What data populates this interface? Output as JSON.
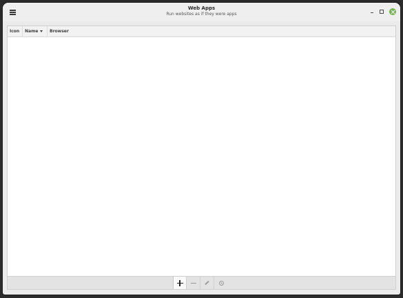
{
  "window": {
    "title": "Web Apps",
    "subtitle": "Run websites as if they were apps"
  },
  "table": {
    "columns": [
      "Icon",
      "Name",
      "Browser"
    ],
    "sorted_column": "Name",
    "sort_direction": "descending",
    "rows": []
  },
  "toolbar": {
    "add_icon": "plus-icon",
    "remove_icon": "minus-icon",
    "edit_icon": "pencil-icon",
    "launch_icon": "run-icon"
  },
  "colors": {
    "close_button": "#75b352",
    "headerbar": "#efefef",
    "background": "#ebebeb"
  }
}
